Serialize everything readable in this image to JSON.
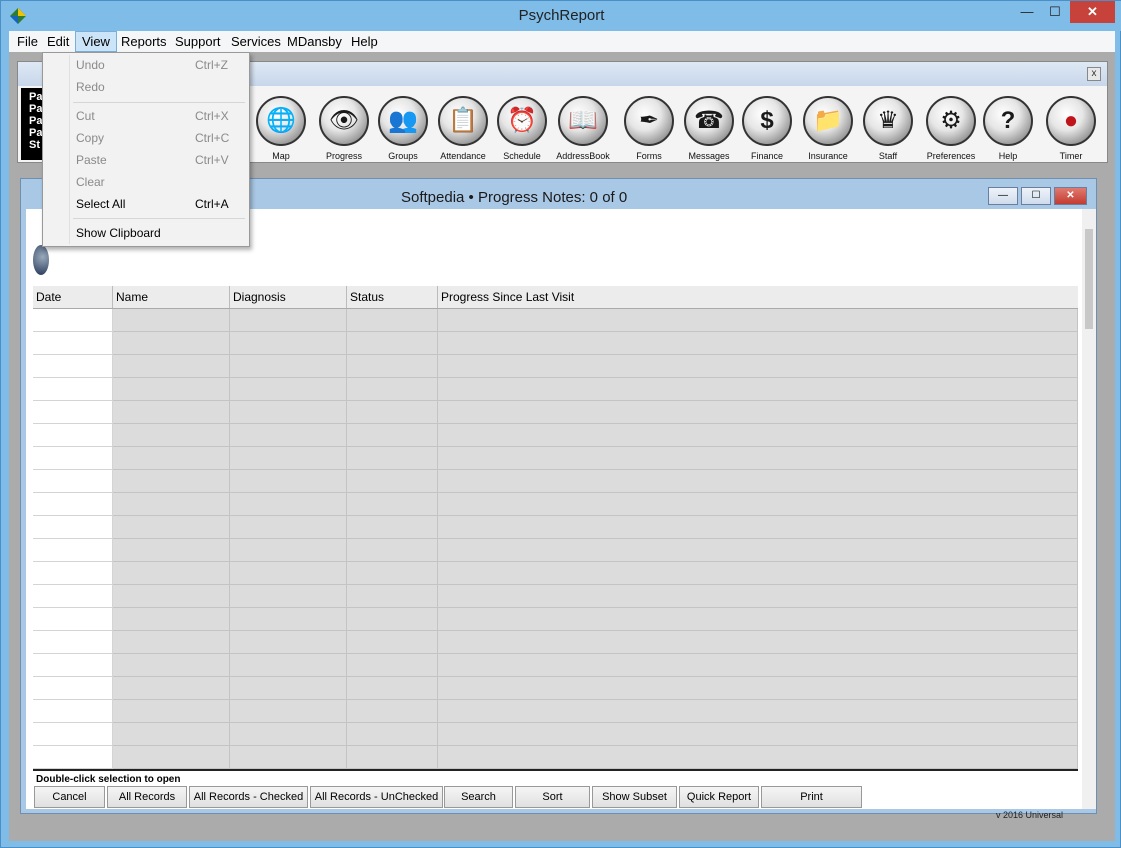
{
  "app": {
    "title": "PsychReport"
  },
  "window_controls": {
    "minimize": "—",
    "maximize": "☐",
    "close": "✕"
  },
  "menubar": {
    "items": [
      {
        "label": "File"
      },
      {
        "label": "Edit"
      },
      {
        "label": "View"
      },
      {
        "label": "Reports"
      },
      {
        "label": "Support"
      },
      {
        "label": "Services"
      },
      {
        "label": "MDansby"
      },
      {
        "label": "Help"
      }
    ]
  },
  "view_menu": {
    "items": [
      {
        "label": "Undo",
        "shortcut": "Ctrl+Z",
        "enabled": false
      },
      {
        "label": "Redo",
        "shortcut": "",
        "enabled": false
      },
      {
        "label": "Cut",
        "shortcut": "Ctrl+X",
        "enabled": false
      },
      {
        "label": "Copy",
        "shortcut": "Ctrl+C",
        "enabled": false
      },
      {
        "label": "Paste",
        "shortcut": "Ctrl+V",
        "enabled": false
      },
      {
        "label": "Clear",
        "shortcut": "",
        "enabled": false
      },
      {
        "label": "Select All",
        "shortcut": "Ctrl+A",
        "enabled": true
      },
      {
        "label": "Show Clipboard",
        "shortcut": "",
        "enabled": true
      }
    ]
  },
  "toolbar": {
    "close": "x",
    "patient_lines": [
      "Pa",
      "Pa",
      "Pa",
      "Pa",
      "St"
    ],
    "tools": [
      {
        "label": "Map",
        "icon": "globe-icon",
        "glyph": "🌐"
      },
      {
        "label": "Progress",
        "icon": "eye-icon",
        "glyph": "👁"
      },
      {
        "label": "Groups",
        "icon": "people-icon",
        "glyph": "👥"
      },
      {
        "label": "Attendance",
        "icon": "clipboard-icon",
        "glyph": "📋"
      },
      {
        "label": "Schedule",
        "icon": "clock-icon",
        "glyph": "⏰"
      },
      {
        "label": "AddressBook",
        "icon": "book-icon",
        "glyph": "📖"
      },
      {
        "label": "Forms",
        "icon": "pen-icon",
        "glyph": "✒"
      },
      {
        "label": "Messages",
        "icon": "phone-icon",
        "glyph": "☎"
      },
      {
        "label": "Finance",
        "icon": "dollar-icon",
        "glyph": "$"
      },
      {
        "label": "Insurance",
        "icon": "folder-icon",
        "glyph": "📁"
      },
      {
        "label": "Staff",
        "icon": "crown-icon",
        "glyph": "♛"
      },
      {
        "label": "Preferences",
        "icon": "gears-icon",
        "glyph": "⚙"
      },
      {
        "label": "Help",
        "icon": "question-icon",
        "glyph": "?"
      },
      {
        "label": "Timer",
        "icon": "record-icon",
        "glyph": "●"
      }
    ]
  },
  "progress_window": {
    "title": "Softpedia  •  Progress Notes: 0 of 0",
    "columns": [
      "Date",
      "Name",
      "Diagnosis",
      "Status",
      "Progress Since Last Visit"
    ],
    "hint": "Double-click selection to open",
    "buttons": [
      {
        "label": "Cancel"
      },
      {
        "label": "All Records"
      },
      {
        "label": "All Records - Checked"
      },
      {
        "label": "All Records - UnChecked"
      },
      {
        "label": "Search"
      },
      {
        "label": "Sort"
      },
      {
        "label": "Show Subset"
      },
      {
        "label": "Quick Report"
      },
      {
        "label": "Print"
      }
    ],
    "version": "v 2016 Universal"
  }
}
